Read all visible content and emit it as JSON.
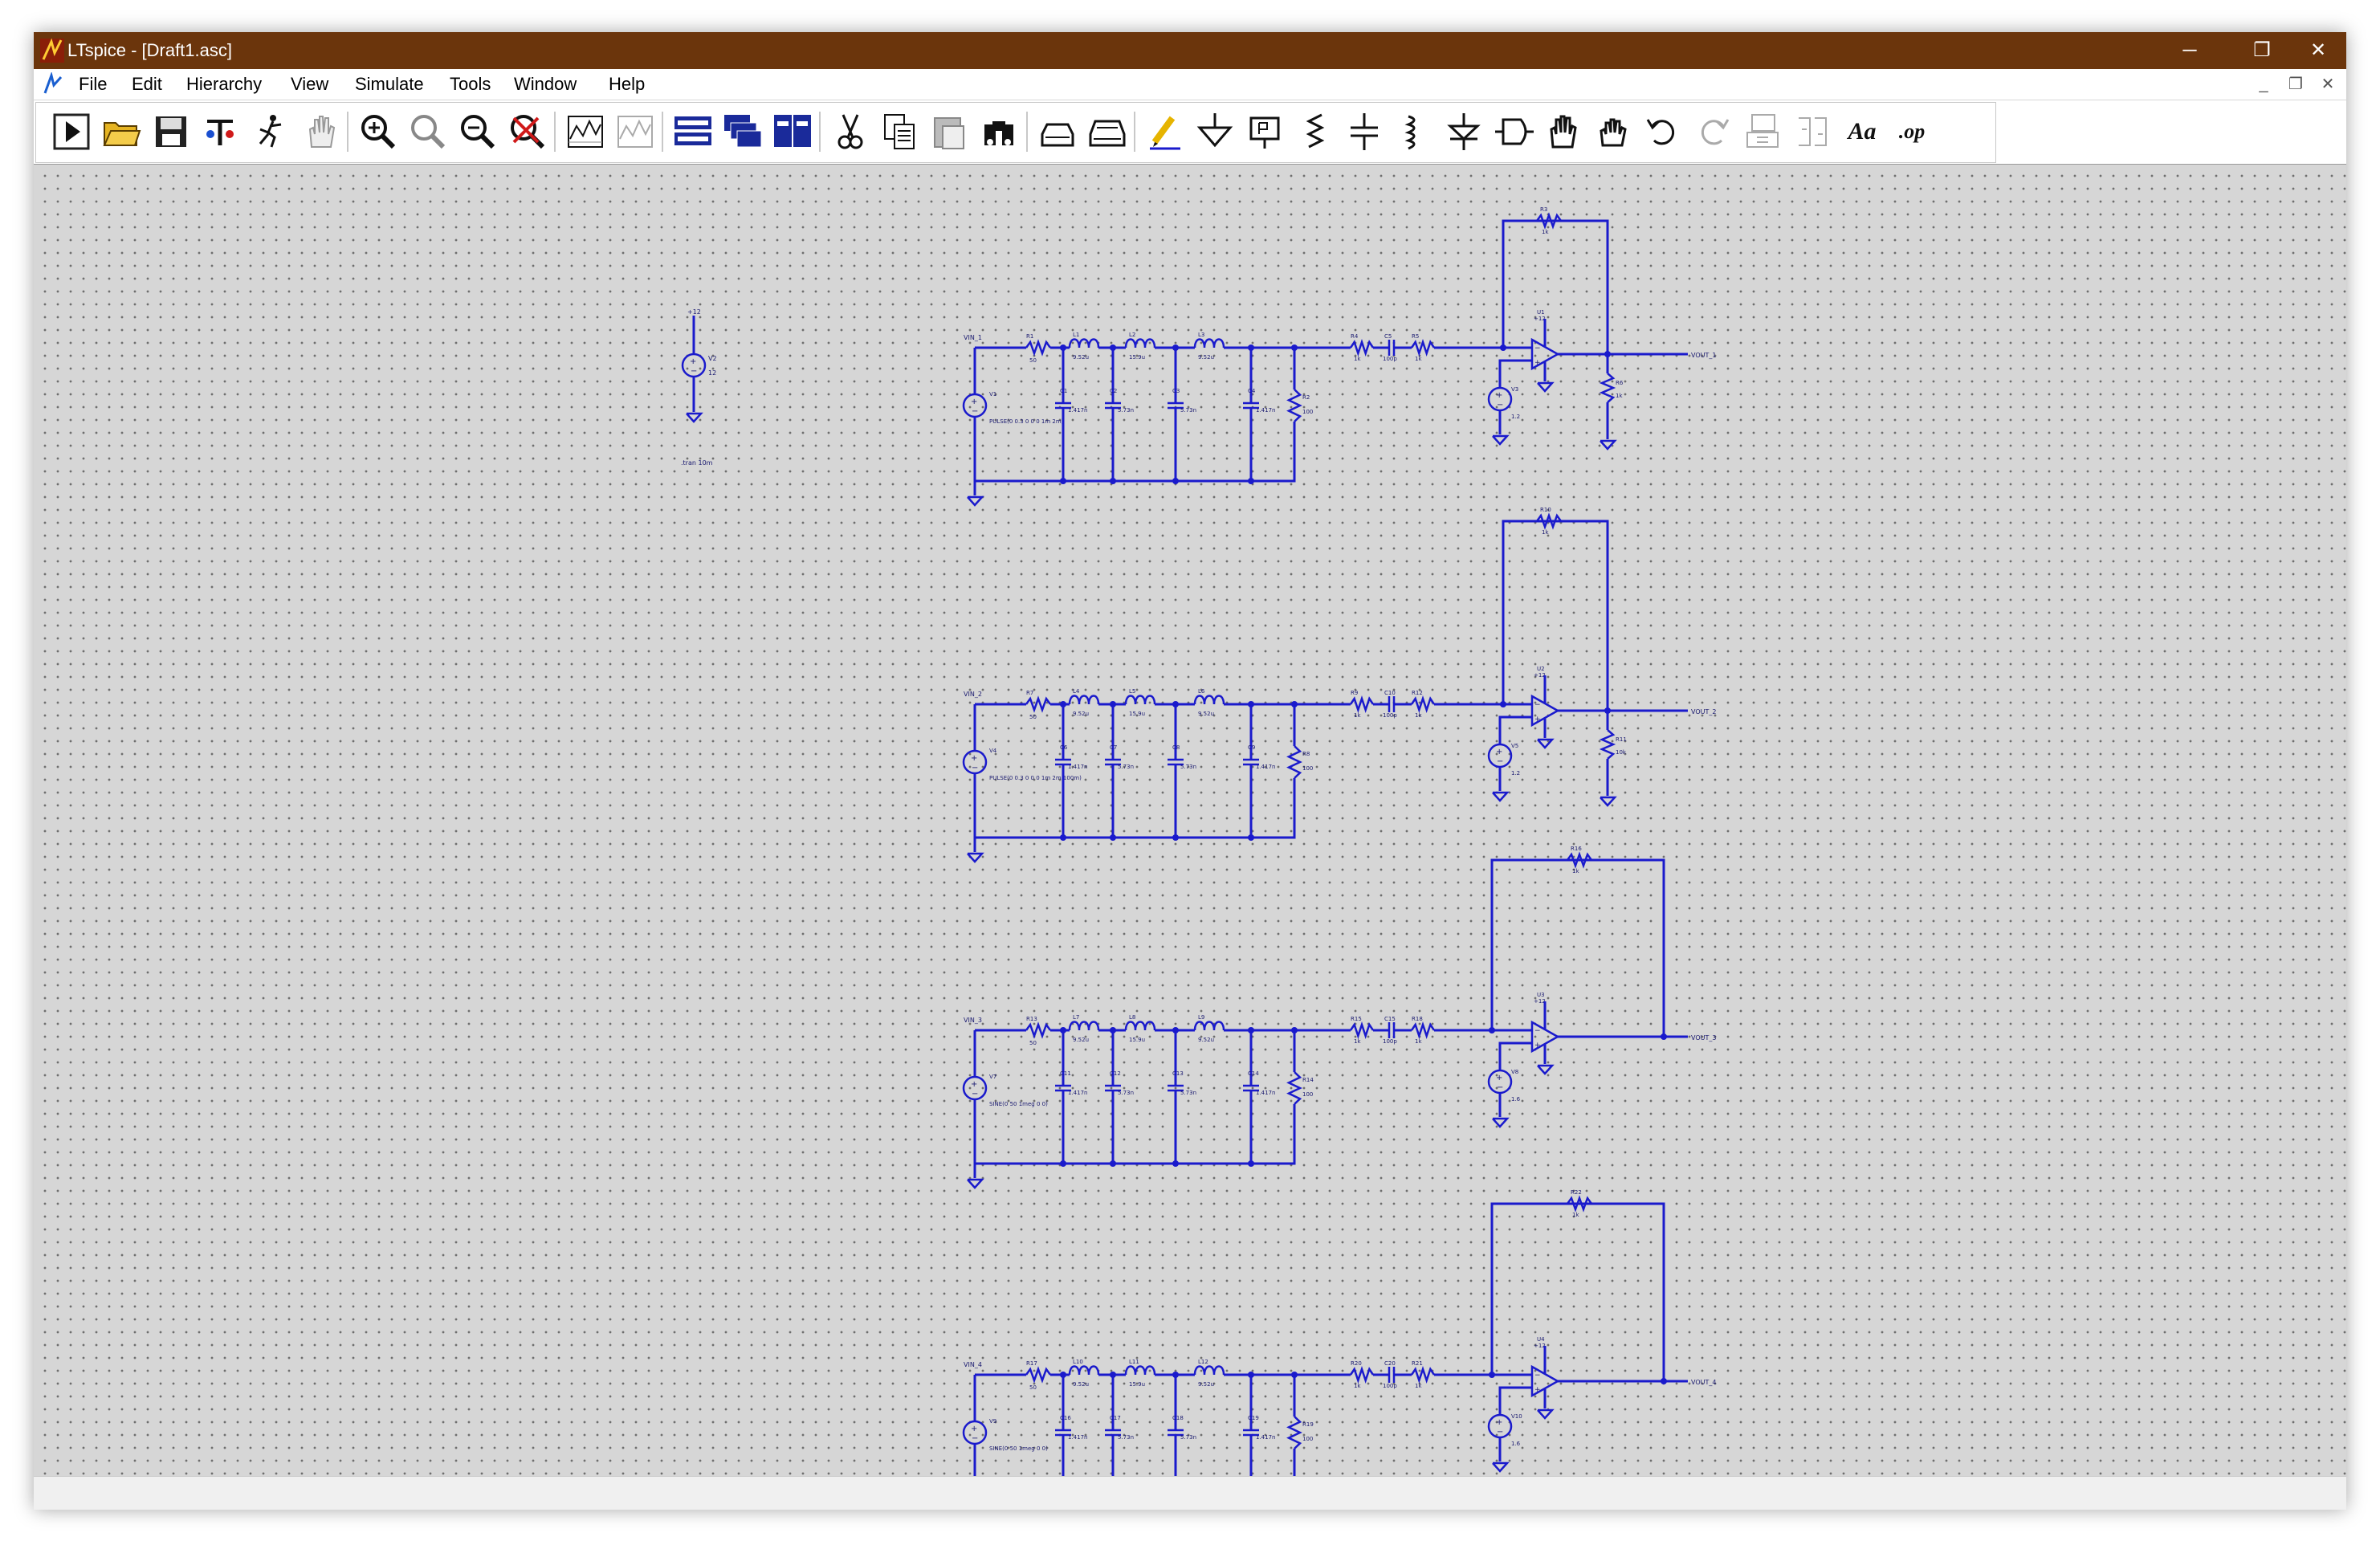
{
  "window": {
    "title": "LTspice - [Draft1.asc]",
    "controls": {
      "minimize": "─",
      "restore": "❐",
      "close": "✕"
    },
    "mdi_controls": {
      "minimize": "_",
      "restore": "❐",
      "close": "✕"
    }
  },
  "menu": {
    "items": [
      {
        "label": "File"
      },
      {
        "label": "Edit"
      },
      {
        "label": "Hierarchy"
      },
      {
        "label": "View"
      },
      {
        "label": "Simulate"
      },
      {
        "label": "Tools"
      },
      {
        "label": "Window"
      },
      {
        "label": "Help"
      }
    ]
  },
  "toolbar": {
    "icons": [
      "run-icon",
      "open-folder-icon",
      "save-icon",
      "control-panel-icon",
      "halt-icon",
      "pan-hand-icon",
      "zoom-in-icon",
      "zoom-area-icon",
      "zoom-out-icon",
      "zoom-fit-icon",
      "waveform-icon",
      "waveform-autorange-icon",
      "tile-horizontal-icon",
      "cascade-icon",
      "tile-vertical-icon",
      "cut-icon",
      "copy-icon",
      "paste-icon",
      "find-icon",
      "print-preview-icon",
      "print-icon",
      "draw-wire-icon",
      "ground-icon",
      "label-net-icon",
      "resistor-icon",
      "capacitor-icon",
      "inductor-icon",
      "diode-icon",
      "component-icon",
      "move-hand-icon",
      "drag-hand-icon",
      "undo-icon",
      "redo-icon",
      "rotate-icon",
      "mirror-icon",
      "text-icon",
      "spice-directive-icon"
    ],
    "text_label": "Aa",
    "op_label": ".op"
  },
  "colors": {
    "titlebar": "#6b350c",
    "canvas": "#d6d6d6",
    "grid_dot": "#6e6e6e",
    "wire": "#1a1acc",
    "component": "#1a1acc",
    "component_text": "#1a1a70"
  },
  "schematic": {
    "standalone": {
      "source_name": "V2",
      "value": "12",
      "top_label": "+12",
      "directive": ".tran 10m"
    },
    "stages": [
      {
        "input": "VIN_1",
        "output": "VOUT_1",
        "source": "V1",
        "source_value": "PULSE(0 0.3 0 0 0 1m 2m)",
        "r_in": "R1",
        "r_in_val": "50",
        "inductors": [
          "L1",
          "L2",
          "L3"
        ],
        "l_vals": [
          "9.52u",
          "15.9u",
          "9.52u"
        ],
        "caps": [
          "C1",
          "C2",
          "C3",
          "C4"
        ],
        "c_vals": [
          "1.417n",
          "5.73n",
          "5.73n",
          "1.417n"
        ],
        "r_load": "R2",
        "r_load_val": "100",
        "r_a": "R4",
        "r_a_val": "1k",
        "c_s": "C5",
        "c_s_val": "100p",
        "r_b": "R5",
        "r_b_val": "1k",
        "r_fb": "R3",
        "r_fb_val": "1k",
        "opamp": "U1",
        "supply": "+12",
        "bias_src": "V3",
        "bias_val": "1.2",
        "r_out": "R6",
        "r_out_val": "1k"
      },
      {
        "input": "VIN_2",
        "output": "VOUT_2",
        "source": "V4",
        "source_value": "PULSE(0 0.3 0 0 0 1m 2m 100m)",
        "r_in": "R7",
        "r_in_val": "50",
        "inductors": [
          "L4",
          "L5",
          "L6"
        ],
        "l_vals": [
          "9.52u",
          "15.9u",
          "9.52u"
        ],
        "caps": [
          "C6",
          "C7",
          "C8",
          "C9"
        ],
        "c_vals": [
          "1.417n",
          "5.73n",
          "5.73n",
          "1.417n"
        ],
        "r_load": "R8",
        "r_load_val": "100",
        "r_a": "R9",
        "r_a_val": "1k",
        "c_s": "C10",
        "c_s_val": "100p",
        "r_b": "R12",
        "r_b_val": "1k",
        "r_fb": "R10",
        "r_fb_val": "1k",
        "opamp": "U2",
        "supply": "+12",
        "bias_src": "V5",
        "bias_val": "1.2",
        "r_out": "R11",
        "r_out_val": "10k"
      },
      {
        "input": "VIN_3",
        "output": "VOUT_3",
        "source": "V7",
        "source_value": "SINE(0 50 1meg 0 0)",
        "r_in": "R13",
        "r_in_val": "50",
        "inductors": [
          "L7",
          "L8",
          "L9"
        ],
        "l_vals": [
          "9.52u",
          "15.9u",
          "9.52u"
        ],
        "caps": [
          "C11",
          "C12",
          "C13",
          "C14"
        ],
        "c_vals": [
          "1.417n",
          "5.73n",
          "5.73n",
          "1.417n"
        ],
        "r_load": "R14",
        "r_load_val": "100",
        "r_a": "R15",
        "r_a_val": "1k",
        "c_s": "C15",
        "c_s_val": "100p",
        "r_b": "R18",
        "r_b_val": "1k",
        "r_fb": "R16",
        "r_fb_val": "1k",
        "opamp": "U3",
        "supply": "+12",
        "bias_src": "V8",
        "bias_val": "1.6",
        "r_out": "",
        "r_out_val": ""
      },
      {
        "input": "VIN_4",
        "output": "VOUT_4",
        "source": "V9",
        "source_value": "SINE(0 50 1meg 0 0)",
        "r_in": "R17",
        "r_in_val": "50",
        "inductors": [
          "L10",
          "L11",
          "L12"
        ],
        "l_vals": [
          "9.52u",
          "15.9u",
          "9.52u"
        ],
        "caps": [
          "C16",
          "C17",
          "C18",
          "C19"
        ],
        "c_vals": [
          "1.417n",
          "5.73n",
          "5.73n",
          "1.417n"
        ],
        "r_load": "R19",
        "r_load_val": "100",
        "r_a": "R20",
        "r_a_val": "1k",
        "c_s": "C20",
        "c_s_val": "100p",
        "r_b": "R21",
        "r_b_val": "1k",
        "r_fb": "R22",
        "r_fb_val": "1k",
        "opamp": "U4",
        "supply": "+12",
        "bias_src": "V10",
        "bias_val": "1.6",
        "r_out": "",
        "r_out_val": ""
      }
    ]
  }
}
